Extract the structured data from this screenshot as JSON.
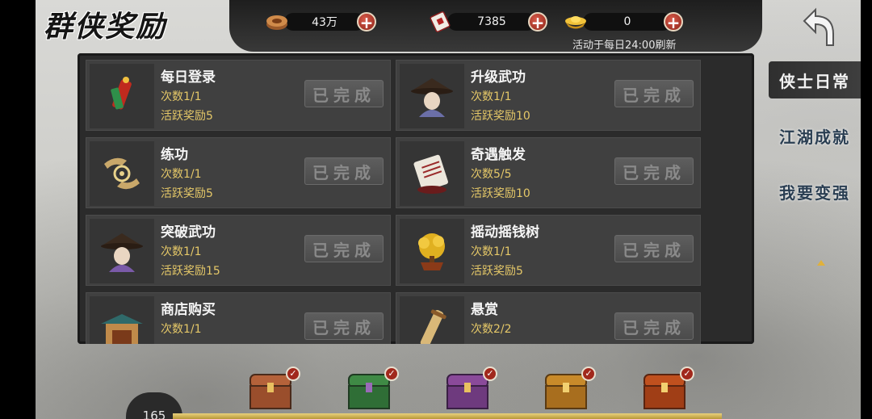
{
  "page": {
    "title": "群侠奖励"
  },
  "currency": [
    {
      "icon": "coin-stack-icon",
      "value": "43万"
    },
    {
      "icon": "scroll-ticket-icon",
      "value": "7385"
    },
    {
      "icon": "gold-ingot-icon",
      "value": "0"
    }
  ],
  "refresh_note": "活动于每日24:00刷新",
  "tabs": [
    {
      "label": "侠士日常",
      "active": true
    },
    {
      "label": "江湖成就",
      "active": false
    },
    {
      "label": "我要变强",
      "active": false
    }
  ],
  "done_label": "已完成",
  "tasks": [
    {
      "name": "每日登录",
      "count": "次数1/1",
      "reward": "活跃奖励5",
      "icon": "firecracker-icon"
    },
    {
      "name": "升级武功",
      "count": "次数1/1",
      "reward": "活跃奖励10",
      "icon": "straw-hat-hero-icon"
    },
    {
      "name": "练功",
      "count": "次数1/1",
      "reward": "活跃奖励5",
      "icon": "palm-qi-icon"
    },
    {
      "name": "奇遇触发",
      "count": "次数5/5",
      "reward": "活跃奖励10",
      "icon": "letter-scroll-icon"
    },
    {
      "name": "突破武功",
      "count": "次数1/1",
      "reward": "活跃奖励15",
      "icon": "straw-hat-hero-icon"
    },
    {
      "name": "摇动摇钱树",
      "count": "次数1/1",
      "reward": "活跃奖励5",
      "icon": "money-tree-icon"
    },
    {
      "name": "商店购买",
      "count": "次数1/1",
      "reward": "",
      "icon": "shop-building-icon"
    },
    {
      "name": "悬赏",
      "count": "次数2/2",
      "reward": "",
      "icon": "bounty-scroll-icon"
    }
  ],
  "activity_points": "165",
  "chests": [
    {
      "color": "#b5623a",
      "claimed": true
    },
    {
      "color": "#3f8a45",
      "claimed": true
    },
    {
      "color": "#8a4a9a",
      "claimed": true
    },
    {
      "color": "#c88a2a",
      "claimed": true
    },
    {
      "color": "#c0501e",
      "claimed": true
    }
  ]
}
